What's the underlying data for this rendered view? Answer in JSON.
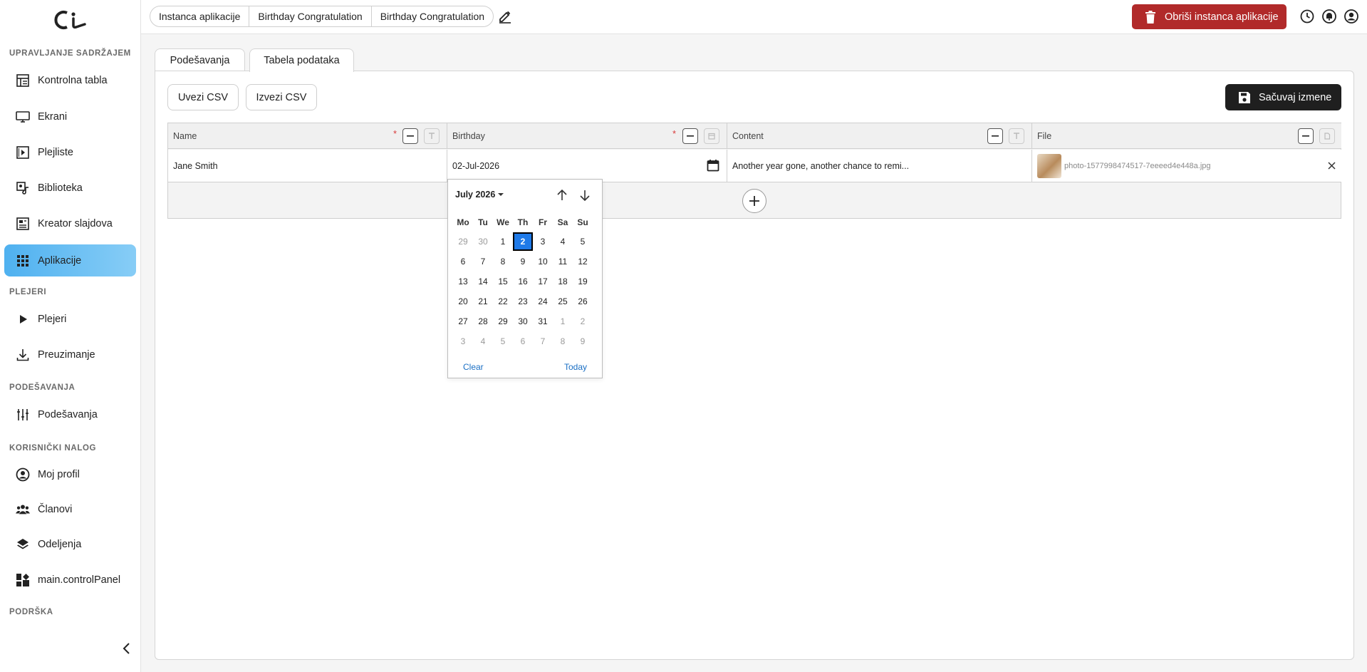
{
  "sidebar": {
    "sections": [
      {
        "title": "UPRAVLJANJE SADRŽAJEM",
        "items": [
          {
            "label": "Kontrolna tabla",
            "icon": "dashboard-table-icon"
          },
          {
            "label": "Ekrani",
            "icon": "monitor-icon"
          },
          {
            "label": "Plejliste",
            "icon": "playlist-icon"
          },
          {
            "label": "Biblioteka",
            "icon": "library-icon"
          },
          {
            "label": "Kreator slajdova",
            "icon": "slide-creator-icon"
          },
          {
            "label": "Aplikacije",
            "icon": "apps-grid-icon",
            "active": true
          }
        ]
      },
      {
        "title": "PLEJERI",
        "items": [
          {
            "label": "Plejeri",
            "icon": "play-icon"
          },
          {
            "label": "Preuzimanje",
            "icon": "download-icon"
          }
        ]
      },
      {
        "title": "PODEŠAVANJA",
        "items": [
          {
            "label": "Podešavanja",
            "icon": "sliders-icon"
          }
        ]
      },
      {
        "title": "KORISNIČKI NALOG",
        "items": [
          {
            "label": "Moj profil",
            "icon": "user-circle-icon"
          },
          {
            "label": "Članovi",
            "icon": "users-icon"
          },
          {
            "label": "Odeljenja",
            "icon": "layers-icon"
          },
          {
            "label": "main.controlPanel",
            "icon": "widgets-icon"
          }
        ]
      },
      {
        "title": "PODRŠKA",
        "items": []
      }
    ]
  },
  "topbar": {
    "breadcrumbs": [
      "Instanca aplikacije",
      "Birthday Congratulation",
      "Birthday Congratulation"
    ],
    "delete_label": "Obriši instanca aplikacije"
  },
  "tabs": {
    "settings": "Podešavanja",
    "data_table": "Tabela podataka"
  },
  "toolbar": {
    "import_csv": "Uvezi CSV",
    "export_csv": "Izvezi CSV",
    "save": "Sačuvaj izmene"
  },
  "table": {
    "columns": [
      {
        "name": "Name",
        "required": true
      },
      {
        "name": "Birthday",
        "required": true
      },
      {
        "name": "Content",
        "required": false
      },
      {
        "name": "File",
        "required": false
      }
    ],
    "rows": [
      {
        "name": "Jane Smith",
        "birthday": "02-Jul-2026",
        "content": "Another year gone, another chance to remi...",
        "file": "photo-1577998474517-7eeeed4e448a.jpg"
      }
    ]
  },
  "datepicker": {
    "month_label": "July 2026",
    "weekdays": [
      "Mo",
      "Tu",
      "We",
      "Th",
      "Fr",
      "Sa",
      "Su"
    ],
    "weeks": [
      [
        "29",
        "30",
        "1",
        "2",
        "3",
        "4",
        "5"
      ],
      [
        "6",
        "7",
        "8",
        "9",
        "10",
        "11",
        "12"
      ],
      [
        "13",
        "14",
        "15",
        "16",
        "17",
        "18",
        "19"
      ],
      [
        "20",
        "21",
        "22",
        "23",
        "24",
        "25",
        "26"
      ],
      [
        "27",
        "28",
        "29",
        "30",
        "31",
        "1",
        "2"
      ],
      [
        "3",
        "4",
        "5",
        "6",
        "7",
        "8",
        "9"
      ]
    ],
    "selected_day": "2",
    "clear_label": "Clear",
    "today_label": "Today"
  },
  "colors": {
    "accent_blue": "#4fb1f0",
    "danger": "#b12a2a",
    "selected_day": "#1f7ae8",
    "dark_button": "#1f1f1f"
  }
}
